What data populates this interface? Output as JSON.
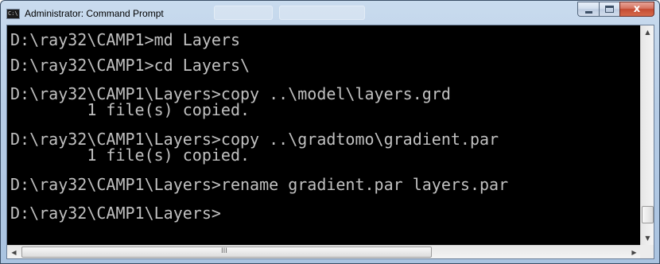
{
  "window": {
    "title": "Administrator: Command Prompt",
    "icon": "cmd-icon",
    "icon_text": "C:\\",
    "close_label": "x",
    "ghost_tabs": [
      "",
      ""
    ]
  },
  "console": {
    "foreground": "#c0c0c0",
    "background": "#000000",
    "lines": [
      "D:\\ray32\\CAMP1>md Layers",
      "",
      "D:\\ray32\\CAMP1>cd Layers\\",
      "",
      "D:\\ray32\\CAMP1\\Layers>copy ..\\model\\layers.grd",
      "        1 file(s) copied.",
      "",
      "D:\\ray32\\CAMP1\\Layers>copy ..\\gradtomo\\gradient.par",
      "        1 file(s) copied.",
      "",
      "D:\\ray32\\CAMP1\\Layers>rename gradient.par layers.par",
      "",
      "D:\\ray32\\CAMP1\\Layers>"
    ]
  },
  "scrollbars": {
    "up_arrow": "▲",
    "down_arrow": "▼",
    "left_arrow": "◀",
    "right_arrow": "▶",
    "grip": "III"
  }
}
